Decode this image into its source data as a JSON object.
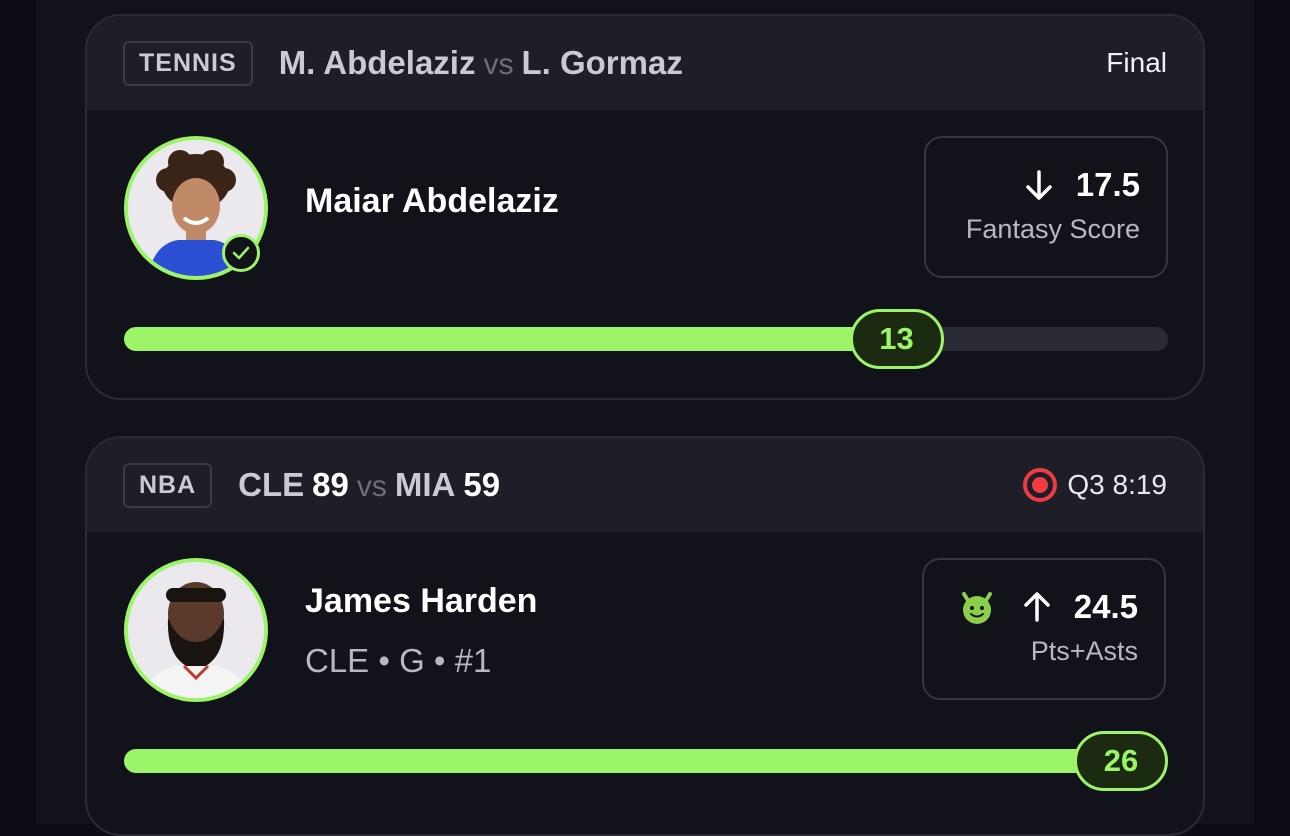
{
  "cards": [
    {
      "sport": "TENNIS",
      "team_a": "M. Abdelaziz",
      "vs": "vs",
      "team_b": "L. Gormaz",
      "status": "Final",
      "player": {
        "name": "Maiar Abdelaziz",
        "avatar_icon": "player-headshot",
        "verified_icon": "check-icon"
      },
      "line": {
        "direction_icon": "arrow-down-icon",
        "value": "17.5",
        "stat": "Fantasy Score"
      },
      "progress": {
        "current": "13",
        "fraction": 0.74
      }
    },
    {
      "sport": "NBA",
      "team_a": "CLE",
      "score_a": "89",
      "vs": "vs",
      "team_b": "MIA",
      "score_b": "59",
      "status": "Q3 8:19",
      "status_icon": "live-indicator-icon",
      "player": {
        "name": "James Harden",
        "meta": "CLE • G • #1",
        "avatar_icon": "player-headshot"
      },
      "line": {
        "badge_icon": "demon-icon",
        "direction_icon": "arrow-up-icon",
        "value": "24.5",
        "stat": "Pts+Asts"
      },
      "progress": {
        "current": "26",
        "fraction": 1.0
      }
    }
  ],
  "colors": {
    "accent": "#9cf569",
    "live": "#ef3b43",
    "card_bg": "#11121a",
    "header_bg": "#1d1e27"
  }
}
